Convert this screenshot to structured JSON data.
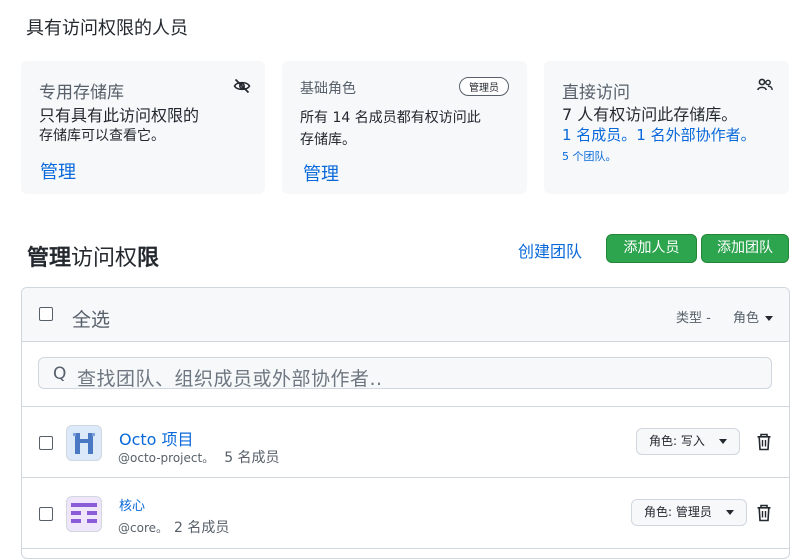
{
  "page_title": "具有访问权限的人员",
  "cards": {
    "private": {
      "title": "专用存储库",
      "line1": "只有具有此访问权限的",
      "line2": "存储库可以查看它。",
      "link": "管理",
      "icon": "eye-slash-icon"
    },
    "base_role": {
      "title": "基础角色",
      "badge": "管理员",
      "line1": "所有 14 名成员都有权访问此",
      "line2": "存储库。",
      "link": "管理"
    },
    "direct": {
      "title": "直接访问",
      "line1": "7 人有权访问此存储库。",
      "line2": "1 名成员。1 名外部协作者。",
      "line3": "5 个团队。",
      "icon": "people-icon"
    }
  },
  "manage": {
    "title_bold1": "管理",
    "title_mid": "访问权",
    "title_bold2": "限",
    "create_team": "创建团队",
    "add_people": "添加人员",
    "add_team": "添加团队"
  },
  "table": {
    "select_all": "全选",
    "filter_type": "类型 -",
    "filter_role": "角色",
    "search_placeholder": "查找团队、组织成员或外部协作者..",
    "rows": [
      {
        "name": "Octo 项目",
        "handle": "@octo-project。",
        "count": "5 名成员",
        "role": "角色: 写入",
        "avatar": "octo-avatar"
      },
      {
        "name": "核心",
        "handle": "@core。",
        "count": "2 名成员",
        "role": "角色: 管理员",
        "avatar": "core-avatar"
      }
    ]
  },
  "colors": {
    "accent": "#0969da",
    "green": "#2da44e",
    "border": "#d0d7de"
  }
}
